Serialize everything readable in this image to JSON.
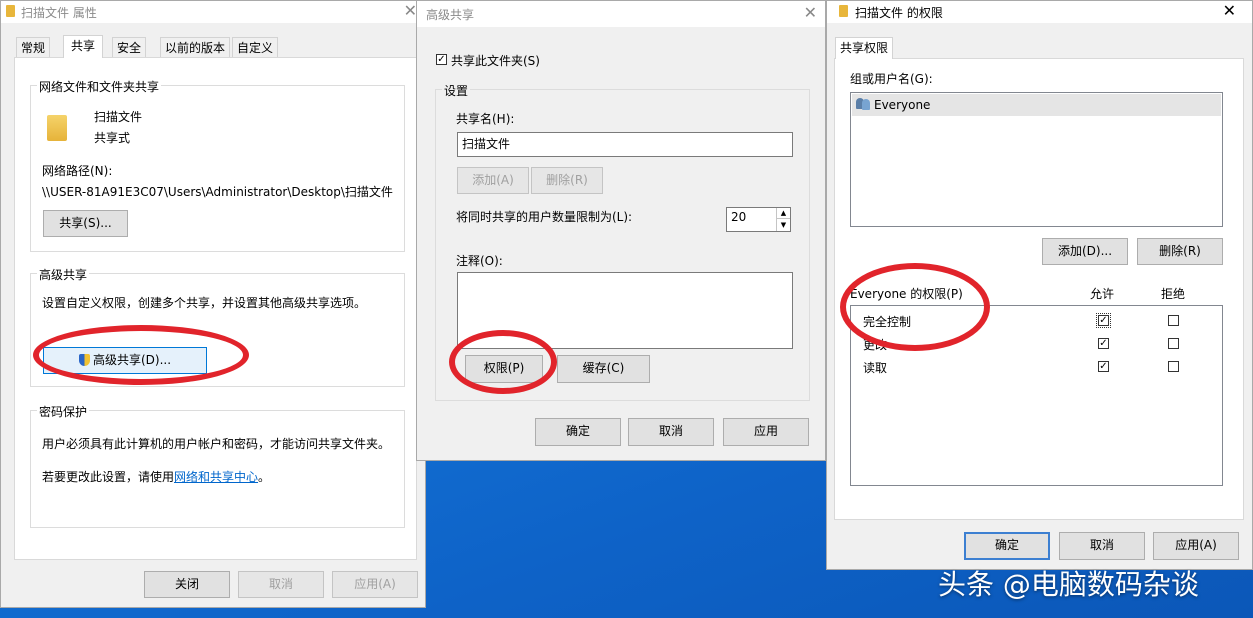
{
  "win1": {
    "title": "扫描文件 属性",
    "tabs": [
      "常规",
      "共享",
      "安全",
      "以前的版本",
      "自定义"
    ],
    "netshare_group": "网络文件和文件夹共享",
    "folder_name": "扫描文件",
    "share_state": "共享式",
    "net_path_label": "网络路径(N):",
    "net_path_value": "\\\\USER-81A91E3C07\\Users\\Administrator\\Desktop\\扫描文件",
    "share_button": "共享(S)...",
    "adv_group": "高级共享",
    "adv_desc": "设置自定义权限，创建多个共享，并设置其他高级共享选项。",
    "adv_button": "高级共享(D)...",
    "pwd_group": "密码保护",
    "pwd_desc": "用户必须具有此计算机的用户帐户和密码，才能访问共享文件夹。",
    "pwd_change_prefix": "若要更改此设置，请使用",
    "pwd_link": "网络和共享中心",
    "pwd_change_suffix": "。",
    "ok": "关闭",
    "cancel": "取消",
    "apply": "应用(A)"
  },
  "win2": {
    "title": "高级共享",
    "share_checkbox": "共享此文件夹(S)",
    "settings_group": "设置",
    "share_name_label": "共享名(H):",
    "share_name_value": "扫描文件",
    "add": "添加(A)",
    "remove": "删除(R)",
    "limit_label": "将同时共享的用户数量限制为(L):",
    "limit_value": "20",
    "comment_label": "注释(O):",
    "comment_value": "",
    "permissions": "权限(P)",
    "cache": "缓存(C)",
    "ok": "确定",
    "cancel": "取消",
    "apply": "应用"
  },
  "win3": {
    "title": "扫描文件 的权限",
    "tab": "共享权限",
    "group_label": "组或用户名(G):",
    "users": [
      "Everyone"
    ],
    "add": "添加(D)...",
    "remove": "删除(R)",
    "perm_label": "Everyone 的权限(P)",
    "allow": "允许",
    "deny": "拒绝",
    "perms": [
      {
        "name": "完全控制",
        "allow": true,
        "deny": false
      },
      {
        "name": "更改",
        "allow": true,
        "deny": false
      },
      {
        "name": "读取",
        "allow": true,
        "deny": false
      }
    ],
    "ok": "确定",
    "cancel": "取消",
    "apply": "应用(A)"
  },
  "watermark": "头条 @电脑数码杂谈",
  "colors": {
    "annotation_red": "#e1242b",
    "desktop_blue": "#1473d6",
    "link_blue": "#0066cc"
  }
}
